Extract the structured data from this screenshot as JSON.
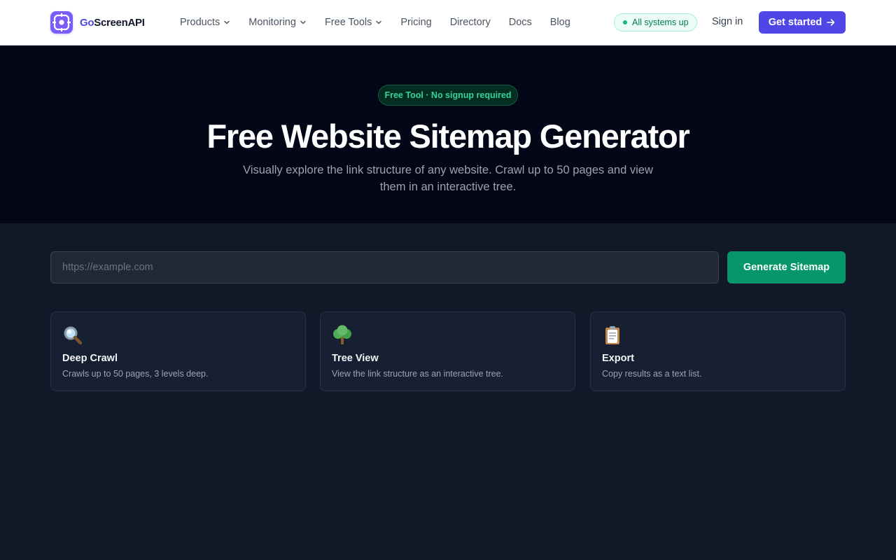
{
  "header": {
    "brand": {
      "prefix": "Go",
      "name": "ScreenAPI",
      "icon": "logo-icon"
    },
    "nav": [
      {
        "label": "Products",
        "has_dropdown": true
      },
      {
        "label": "Monitoring",
        "has_dropdown": true
      },
      {
        "label": "Free Tools",
        "has_dropdown": true
      },
      {
        "label": "Pricing",
        "has_dropdown": false
      },
      {
        "label": "Directory",
        "has_dropdown": false
      },
      {
        "label": "Docs",
        "has_dropdown": false
      },
      {
        "label": "Blog",
        "has_dropdown": false
      }
    ],
    "status": "All systems up",
    "sign_in": "Sign in",
    "cta": "Get started"
  },
  "hero": {
    "badge": "Free Tool · No signup required",
    "title": "Free Website Sitemap Generator",
    "subtitle": "Visually explore the link structure of any website. Crawl up to 50 pages and view them in an interactive tree."
  },
  "tool": {
    "url_placeholder": "https://example.com",
    "url_value": "",
    "generate_label": "Generate Sitemap"
  },
  "features": [
    {
      "icon": "magnifier-icon",
      "title": "Deep Crawl",
      "description": "Crawls up to 50 pages, 3 levels deep."
    },
    {
      "icon": "tree-icon",
      "title": "Tree View",
      "description": "View the link structure as an interactive tree."
    },
    {
      "icon": "clipboard-icon",
      "title": "Export",
      "description": "Copy results as a text list."
    }
  ],
  "colors": {
    "brand": "#4f46e5",
    "logo": "#7c5cf6",
    "success": "#059669",
    "hero_bg": "#020617",
    "page_bg": "#111827"
  }
}
